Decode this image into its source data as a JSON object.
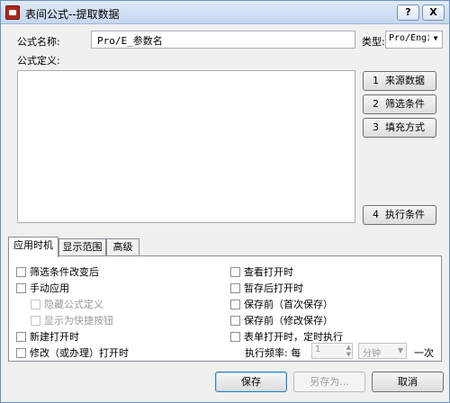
{
  "window": {
    "title": "表间公式--提取数据",
    "help_label": "?",
    "close_label": "X"
  },
  "formula": {
    "name_label": "公式名称:",
    "name_value": "Pro/E_参数名",
    "type_label": "类型:",
    "type_value": "Pro/Engi",
    "definition_label": "公式定义:"
  },
  "side_buttons": [
    {
      "num": "1",
      "label": "来源数据"
    },
    {
      "num": "2",
      "label": "筛选条件"
    },
    {
      "num": "3",
      "label": "填充方式"
    },
    {
      "num": "4",
      "label": "执行条件"
    }
  ],
  "tabs": [
    {
      "label": "应用时机",
      "active": true
    },
    {
      "label": "显示范围",
      "active": false
    },
    {
      "label": "高级",
      "active": false
    }
  ],
  "left_options": [
    {
      "label": "筛选条件改变后",
      "checked": false,
      "enabled": true
    },
    {
      "label": "手动应用",
      "checked": false,
      "enabled": true
    },
    {
      "label": "隐藏公式定义",
      "checked": false,
      "enabled": false
    },
    {
      "label": "显示为快捷按钮",
      "checked": false,
      "enabled": false
    },
    {
      "label": "新建打开时",
      "checked": false,
      "enabled": true
    },
    {
      "label": "修改（或办理）打开时",
      "checked": false,
      "enabled": true
    }
  ],
  "right_options": [
    {
      "label": "查看打开时",
      "checked": false,
      "enabled": true
    },
    {
      "label": "暂存后打开时",
      "checked": false,
      "enabled": true
    },
    {
      "label": "保存前（首次保存）",
      "checked": false,
      "enabled": true
    },
    {
      "label": "保存前（修改保存）",
      "checked": false,
      "enabled": true
    },
    {
      "label": "表单打开时，定时执行",
      "checked": false,
      "enabled": true
    }
  ],
  "schedule": {
    "prefix": "执行频率: 每",
    "interval_value": "1",
    "unit_value": "分钟",
    "suffix": "一次"
  },
  "footer": {
    "save_label": "保存",
    "save_as_label": "另存为...",
    "cancel_label": "取消"
  }
}
